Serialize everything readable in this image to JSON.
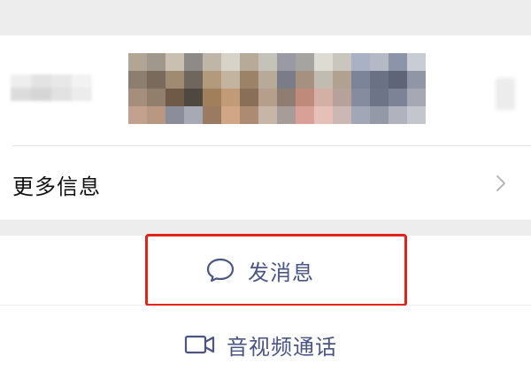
{
  "profile": {
    "more_info_label": "更多信息"
  },
  "actions": {
    "send_message_label": "发消息",
    "video_call_label": "音视频通话"
  },
  "icons": {
    "send_message": "chat-bubble-icon",
    "video_call": "video-camera-icon",
    "more_info_arrow": "chevron-right-icon"
  },
  "colors": {
    "action_text": "#4a5583",
    "highlight_box": "#e0241a",
    "background": "#ededed",
    "card": "#ffffff"
  }
}
